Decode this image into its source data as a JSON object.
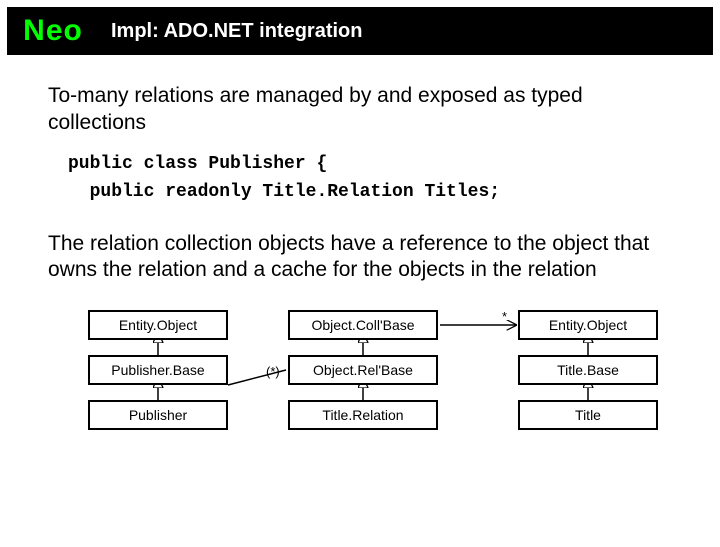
{
  "header": {
    "logo": "Neo",
    "title": "Impl: ADO.NET integration"
  },
  "para1": "To-many relations are managed by and exposed as typed collections",
  "code": "public class Publisher {\n  public readonly Title.Relation Titles;",
  "para2": "The relation collection objects have a reference to the object that owns the relation and a cache for the objects in the relation",
  "diagram": {
    "col1": {
      "r1": "Entity.Object",
      "r2": "Publisher.Base",
      "r3": "Publisher"
    },
    "col2": {
      "r1": "Object.Coll'Base",
      "r2": "Object.Rel'Base",
      "r3": "Title.Relation"
    },
    "col3": {
      "r1": "Entity.Object",
      "r2": "Title.Base",
      "r3": "Title"
    },
    "labels": {
      "left": "(*)",
      "right": "*"
    }
  }
}
